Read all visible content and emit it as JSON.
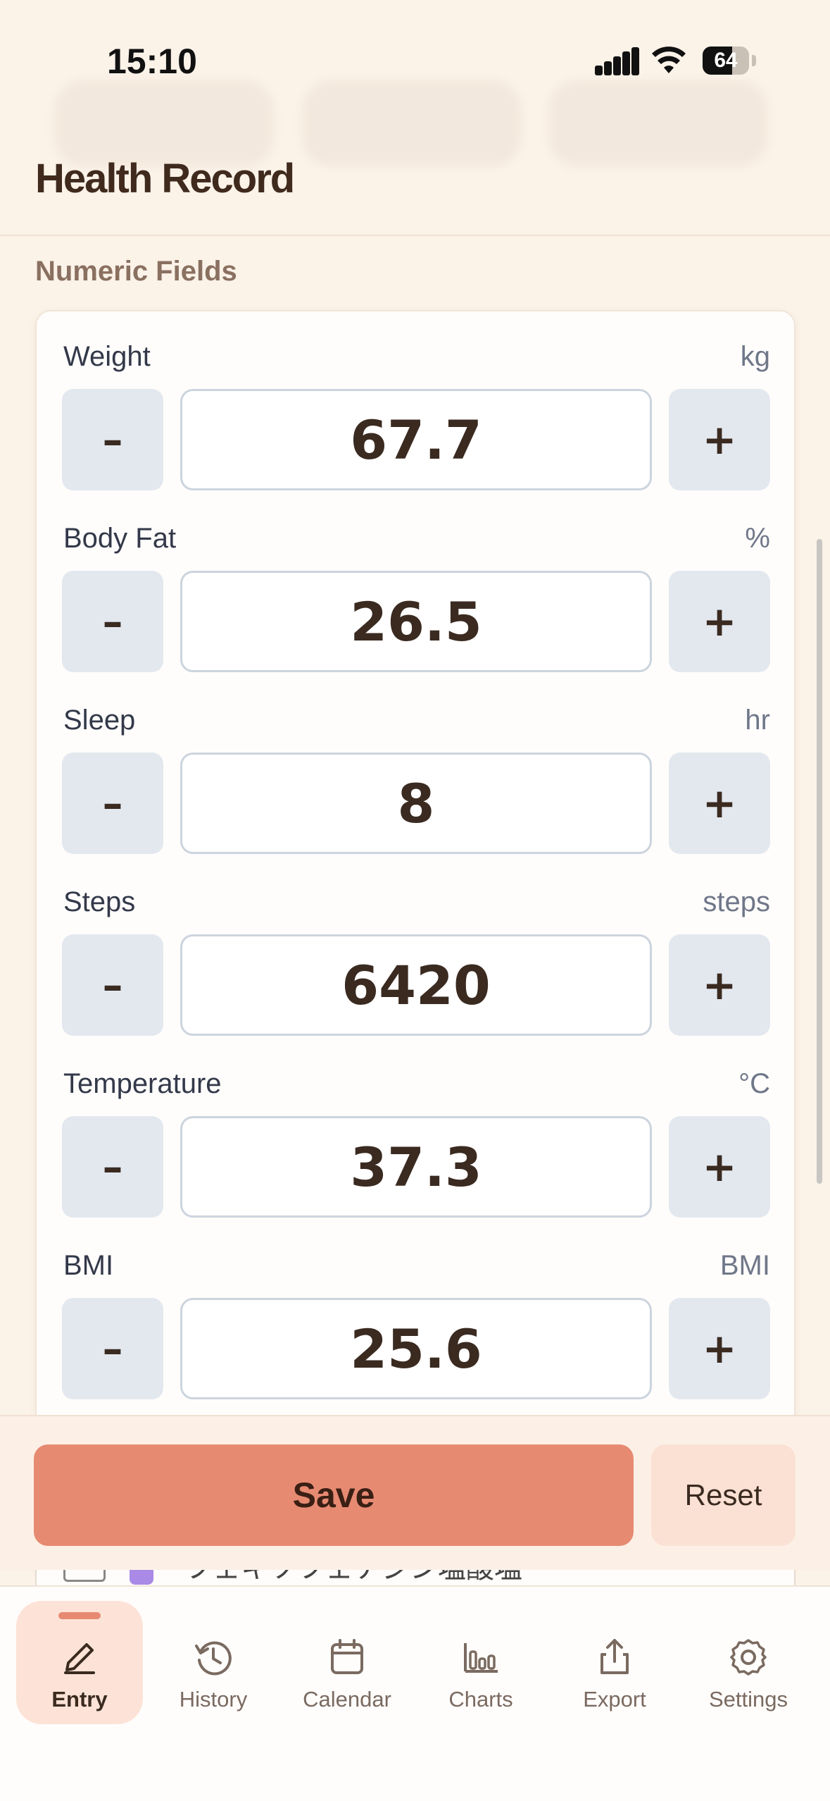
{
  "status_bar": {
    "time": "15:10",
    "battery": "64",
    "signal_icon": "signal-bars-icon",
    "wifi_icon": "wifi-icon",
    "battery_icon": "battery-icon"
  },
  "header": {
    "title": "Health Record"
  },
  "section": {
    "label": "Numeric Fields"
  },
  "fields": [
    {
      "name": "Weight",
      "unit": "kg",
      "value": "67.7",
      "minus": "–",
      "plus": "+"
    },
    {
      "name": "Body Fat",
      "unit": "%",
      "value": "26.5",
      "minus": "–",
      "plus": "+"
    },
    {
      "name": "Sleep",
      "unit": "hr",
      "value": "8",
      "minus": "–",
      "plus": "+"
    },
    {
      "name": "Steps",
      "unit": "steps",
      "value": "6420",
      "minus": "–",
      "plus": "+"
    },
    {
      "name": "Temperature",
      "unit": "°C",
      "value": "37.3",
      "minus": "–",
      "plus": "+"
    },
    {
      "name": "BMI",
      "unit": "BMI",
      "value": "25.6",
      "minus": "–",
      "plus": "+"
    }
  ],
  "peek_row": {
    "text": "フェキソフェナジン塩酸塩"
  },
  "actions": {
    "save_label": "Save",
    "reset_label": "Reset"
  },
  "tabs": [
    {
      "label": "Entry",
      "icon": "pencil-icon",
      "active": true
    },
    {
      "label": "History",
      "icon": "history-clock-icon",
      "active": false
    },
    {
      "label": "Calendar",
      "icon": "calendar-icon",
      "active": false
    },
    {
      "label": "Charts",
      "icon": "bar-chart-icon",
      "active": false
    },
    {
      "label": "Export",
      "icon": "share-upload-icon",
      "active": false
    },
    {
      "label": "Settings",
      "icon": "gear-icon",
      "active": false
    }
  ],
  "colors": {
    "accent": "#e78a72",
    "background": "#fbf2e8",
    "stepper": "#e3e8ef",
    "active_tab": "#fde3d7"
  }
}
